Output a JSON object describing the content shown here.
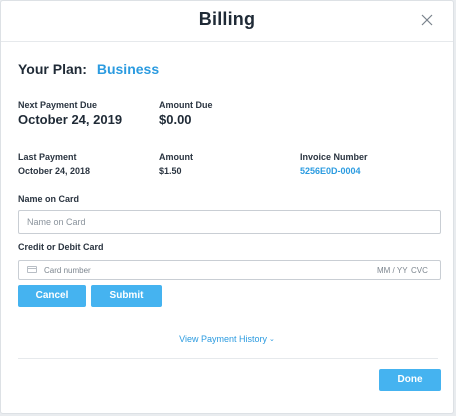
{
  "modal": {
    "title": "Billing"
  },
  "plan": {
    "label": "Your Plan:",
    "name": "Business"
  },
  "next_payment": {
    "label": "Next Payment Due",
    "value": "October 24, 2019"
  },
  "amount_due": {
    "label": "Amount Due",
    "value": "$0.00"
  },
  "last_payment": {
    "label": "Last Payment",
    "value": "October 24, 2018"
  },
  "amount": {
    "label": "Amount",
    "value": "$1.50"
  },
  "invoice": {
    "label": "Invoice Number",
    "value": "5256E0D-0004"
  },
  "name_on_card": {
    "label": "Name on Card",
    "placeholder": "Name on Card",
    "value": ""
  },
  "card": {
    "label": "Credit or Debit Card",
    "number_placeholder": "Card number",
    "expiry_placeholder": "MM / YY",
    "cvc_placeholder": "CVC"
  },
  "buttons": {
    "cancel": "Cancel",
    "submit": "Submit",
    "done": "Done"
  },
  "history_link": "View Payment History",
  "colors": {
    "accent": "#2b9be0",
    "button": "#45b3f0",
    "text": "#1f2a36"
  }
}
